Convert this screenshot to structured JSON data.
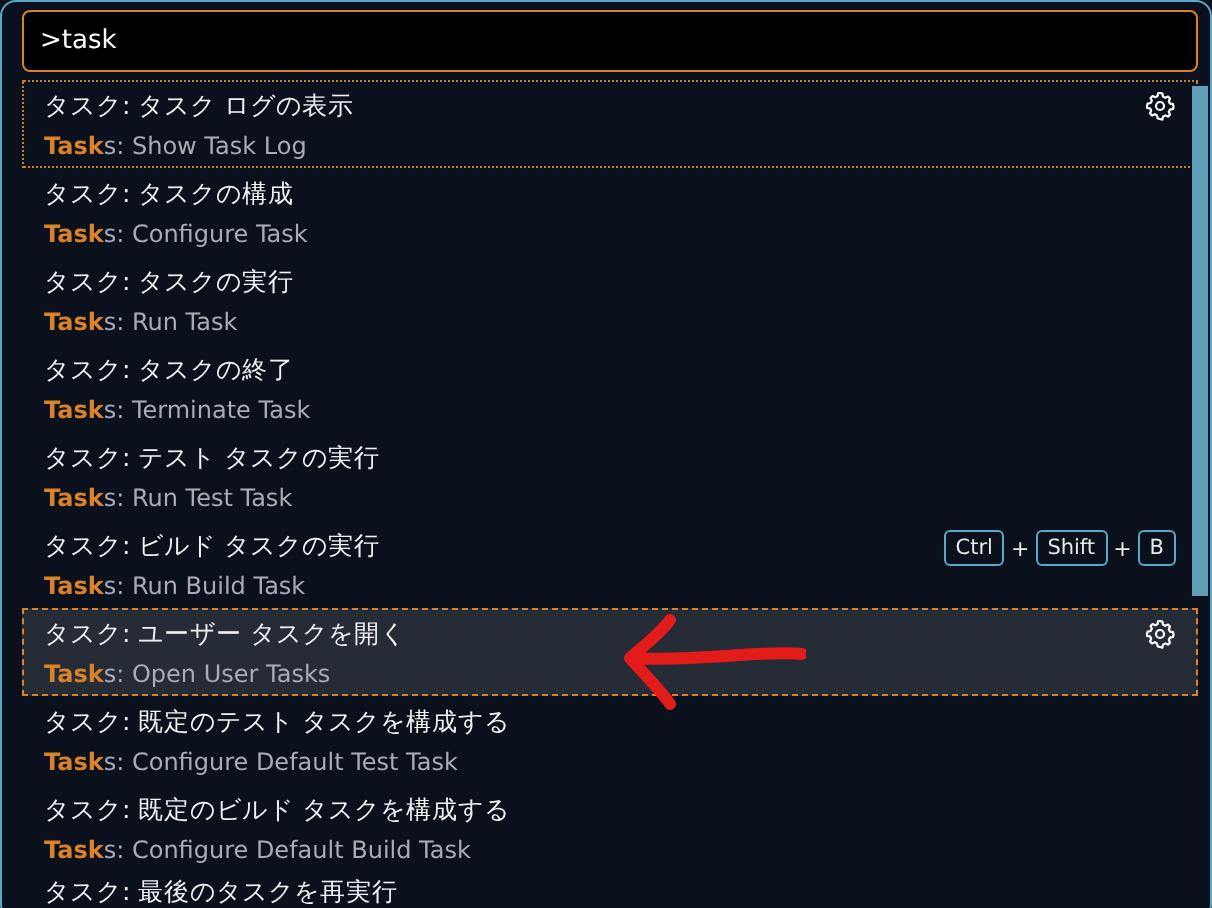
{
  "input": {
    "value": ">task"
  },
  "items": [
    {
      "title": "タスク: タスク ログの表示",
      "detail": "**Task**s: Show Task Log",
      "selected": false,
      "focused": true,
      "gear": true
    },
    {
      "title": "タスク: タスクの構成",
      "detail": "**Task**s: Configure Task",
      "selected": false,
      "focused": false,
      "gear": false
    },
    {
      "title": "タスク: タスクの実行",
      "detail": "**Task**s: Run Task",
      "selected": false,
      "focused": false,
      "gear": false
    },
    {
      "title": "タスク: タスクの終了",
      "detail": "**Task**s: Terminate Task",
      "selected": false,
      "focused": false,
      "gear": false
    },
    {
      "title": "タスク: テスト タスクの実行",
      "detail": "**Task**s: Run Test Task",
      "selected": false,
      "focused": false,
      "gear": false
    },
    {
      "title": "タスク: ビルド タスクの実行",
      "detail": "**Task**s: Run Build Task",
      "selected": false,
      "focused": false,
      "gear": false,
      "keys": [
        "Ctrl",
        "+",
        "Shift",
        "+",
        "B"
      ]
    },
    {
      "title": "タスク: ユーザー タスクを開く",
      "detail": "**Task**s: Open User Tasks",
      "selected": true,
      "focused": false,
      "gear": true
    },
    {
      "title": "タスク: 既定のテスト タスクを構成する",
      "detail": "**Task**s: Configure Default Test Task",
      "selected": false,
      "focused": false,
      "gear": false
    },
    {
      "title": "タスク: 既定のビルド タスクを構成する",
      "detail": "**Task**s: Configure Default Build Task",
      "selected": false,
      "focused": false,
      "gear": false
    },
    {
      "title": "タスク: 最後のタスクを再実行",
      "selected": false,
      "focused": false,
      "gear": false
    }
  ]
}
